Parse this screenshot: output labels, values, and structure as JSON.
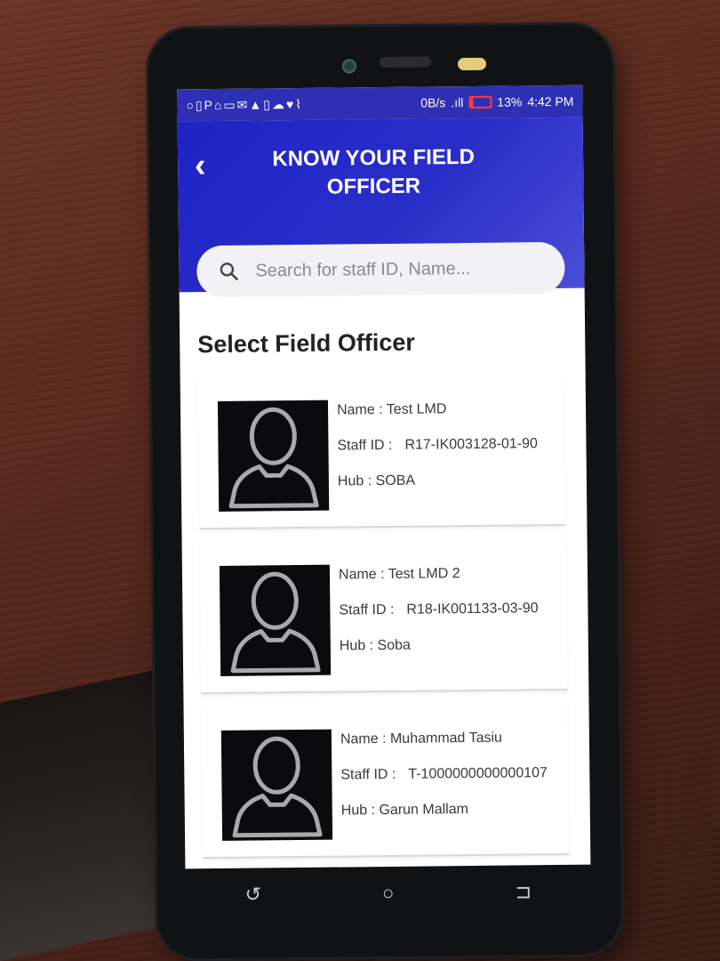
{
  "statusbar": {
    "icons": "○▯P⌂▭✉▲▯☁♥⌇",
    "net_speed": "0B/s",
    "signal": ".ıll",
    "battery": "13%",
    "time": "4:42 PM"
  },
  "header": {
    "back_icon": "‹",
    "title": "KNOW YOUR FIELD OFFICER",
    "search_placeholder": "Search for staff ID, Name..."
  },
  "section_title": "Select Field Officer",
  "officers": [
    {
      "name": "Name : Test LMD",
      "staff_label": "Staff ID :",
      "staff_id": "R17-IK003128-01-90",
      "hub": "Hub : SOBA"
    },
    {
      "name": "Name : Test LMD 2",
      "staff_label": "Staff ID :",
      "staff_id": "R18-IK001133-03-90",
      "hub": "Hub : Soba"
    },
    {
      "name": "Name : Muhammad Tasiu",
      "staff_label": "Staff ID :",
      "staff_id": "T-1000000000000107",
      "hub": "Hub : Garun Mallam"
    }
  ],
  "navbar": {
    "back": "↺",
    "home": "○",
    "recents": "⊐"
  },
  "colors": {
    "header": "#2a2ec8",
    "avatar_bg": "#0b0b0d"
  }
}
